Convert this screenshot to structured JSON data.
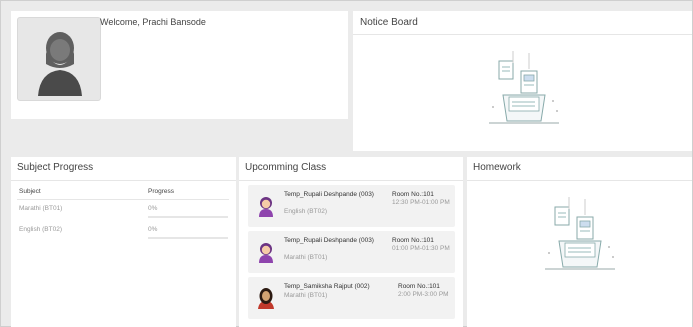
{
  "profile": {
    "welcome": "Welcome, Prachi Bansode"
  },
  "notice_board": {
    "title": "Notice Board"
  },
  "subject_progress": {
    "title": "Subject Progress",
    "headers": [
      "Subject",
      "Progress"
    ],
    "rows": [
      {
        "subject": "Marathi (BT01)",
        "progress": "0%"
      },
      {
        "subject": "English (BT02)",
        "progress": "0%"
      }
    ]
  },
  "upcoming_class": {
    "title": "Upcomming Class",
    "items": [
      {
        "teacher": "Temp_Rupali Deshpande (003)",
        "subject": "English (BT02)",
        "room": "Room No.:101",
        "time": "12:30 PM-01:00 PM"
      },
      {
        "teacher": "Temp_Rupali Deshpande (003)",
        "subject": "Marathi (BT01)",
        "room": "Room No.:101",
        "time": "01:00 PM-01:30 PM"
      },
      {
        "teacher": "Temp_Samiksha Rajput (002)",
        "subject": "Marathi (BT01)",
        "room": "Room No.:101",
        "time": "2:00 PM-3:00 PM"
      }
    ]
  },
  "homework": {
    "title": "Homework"
  }
}
